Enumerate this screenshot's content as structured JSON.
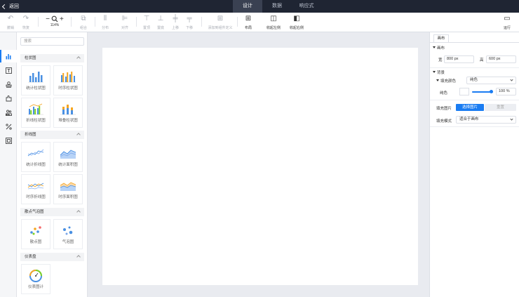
{
  "topbar": {
    "back_label": "返回",
    "tabs": [
      {
        "label": "设计",
        "active": true
      },
      {
        "label": "数据",
        "active": false
      },
      {
        "label": "响应式",
        "active": false
      }
    ]
  },
  "toolbar": {
    "undo": "撤销",
    "redo": "恢复",
    "zoom": "114%",
    "zoom_minus": "−",
    "zoom_plus": "+",
    "combine": "组合",
    "distribute": "分布",
    "align": "对齐",
    "top": "置顶",
    "bottom": "置底",
    "up": "上移",
    "down": "下移",
    "add_module": "添加到组件定义",
    "layout": "布局",
    "collapse_left": "收起左侧",
    "collapse_right": "收起右侧",
    "run": "运行"
  },
  "panel": {
    "search_placeholder": "搜索",
    "groups": {
      "bar": "柱状图",
      "line": "折线图",
      "scatter": "散点气泡图",
      "gauge": "仪表盘"
    },
    "cards": {
      "stat_bar": "统计柱状图",
      "series_bar": "时序柱状图",
      "line_bar": "折线柱状图",
      "stack_bar": "堆叠柱状图",
      "stat_line": "统计折线图",
      "stat_area": "统计面积图",
      "series_line": "时序折线图",
      "series_area": "时序面积图",
      "scatter": "散点图",
      "bubble": "气泡图",
      "gauge": "仪表图计"
    }
  },
  "props": {
    "tab": "画布",
    "canvas_section": "画布",
    "width_label": "宽",
    "width_value": "800 px",
    "height_label": "高",
    "height_value": "600 px",
    "bg_section": "背景",
    "fill_color_label": "填充颜色",
    "fill_color_value": "纯色",
    "solid_label": "纯色",
    "opacity_value": "100 %",
    "opacity": 1.0,
    "fill_image_label": "填充图片",
    "choose_image": "选择图片",
    "reset": "重置",
    "fill_mode_label": "填充模式",
    "fill_mode_value": "适合于画布"
  },
  "colors": {
    "accent": "#1a7cf2",
    "topbar": "#1f2533"
  }
}
